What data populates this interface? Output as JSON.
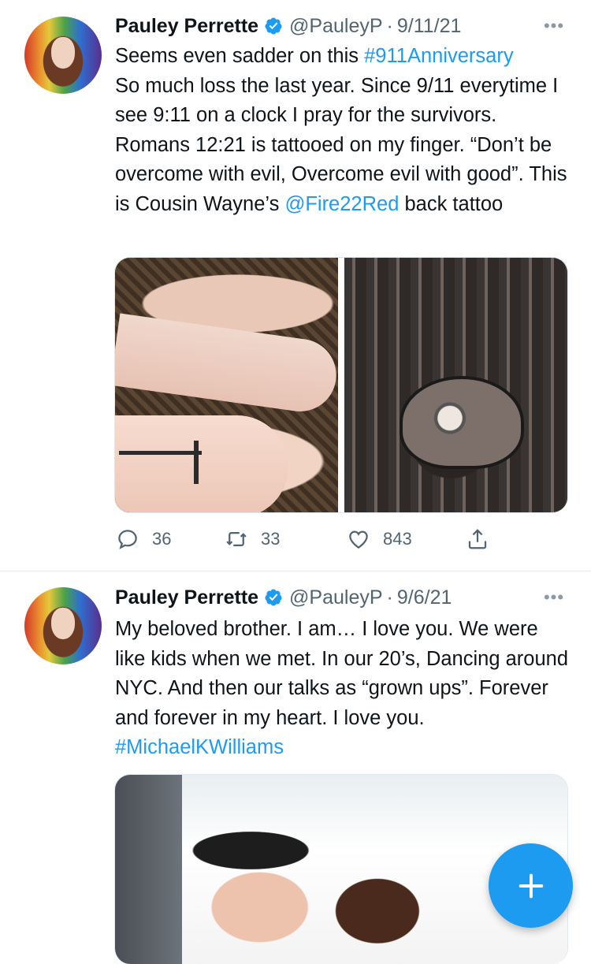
{
  "tweets": [
    {
      "author_name": "Pauley Perrette",
      "handle": "@PauleyP",
      "separator": "·",
      "date": "9/11/21",
      "text_line1_prefix": "Seems even sadder on this ",
      "hashtag": "#911Anniversary",
      "text_middle": "So much loss the last year. Since 9/11 everytime I see 9:11 on a clock I pray for the survivors. Romans 12:21 is tattooed on my finger. “Don’t be overcome with evil, Overcome evil with good”. This is Cousin Wayne’s",
      "mention": "@Fire22Red",
      "text_suffix": " back tattoo",
      "replies": "36",
      "retweets": "33",
      "likes": "843"
    },
    {
      "author_name": "Pauley Perrette",
      "handle": "@PauleyP",
      "separator": "·",
      "date": "9/6/21",
      "text": "My beloved brother. I am… I love you. We were like kids when we met. In our 20’s, Dancing around NYC. And then our talks as “grown ups”. Forever and forever in my heart. I love you. ",
      "hashtag": "#MichaelKWilliams"
    }
  ],
  "icons": {
    "verified": "verified-badge-icon",
    "more": "more-icon",
    "reply": "reply-icon",
    "retweet": "retweet-icon",
    "like": "heart-icon",
    "share": "share-icon",
    "compose": "compose-plus-icon"
  },
  "colors": {
    "link": "#1d9bf0",
    "text": "#0f1419",
    "secondary": "#536471",
    "fab": "#1d9bf0"
  }
}
